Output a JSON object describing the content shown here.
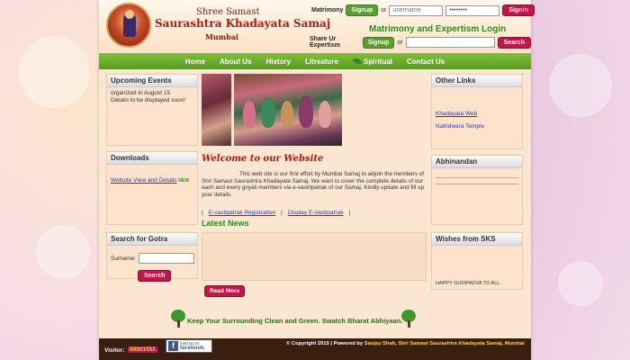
{
  "header": {
    "brand_small": "Shree Samast",
    "brand_big": "Saurashtra Khadayata Samaj",
    "brand_city": "Mumbai",
    "matrimony_label": "Matrimony",
    "signup_label": "Signup",
    "or_label": "or",
    "username_placeholder": "username",
    "password_value": "••••••••",
    "signin_label": "Signin",
    "login_title": "Matrimony and Expertism Login",
    "share_label": "Share Ur Expertism",
    "signup2_label": "Signup",
    "search_label": "Search"
  },
  "nav": {
    "items": [
      "Home",
      "About Us",
      "History",
      "Litreature",
      "Spiritual",
      "Contact Us"
    ]
  },
  "left": {
    "upcoming_title": "Upcoming Events",
    "upcoming_text_1": "organized in August 15",
    "upcoming_text_2": "Details to be displayed soon!",
    "downloads_title": "Downloads",
    "downloads_link_1": "Website View and Details",
    "new_badge": "NEW",
    "gotra_title": "Search for Gotra",
    "surname_label": "Surname:",
    "gotra_search_label": "Search"
  },
  "center": {
    "welcome_title": "Welcome to our Website",
    "welcome_text": "This web site is our first effort by Mumbai Samaj to adjoin the members of Shri Samast Saurashtra Khadayata Samaj. We want to cover the complete details of our each and every gnyati members via e-vastripatrak of our Samaj. Kindly update and fill up your details.",
    "link_1": "E-vastipatrak Registration",
    "link_2": "Display E-Vastipatrak",
    "news_title": "Latest News",
    "read_more_label": "Read More",
    "slogan": "Keep Your Surrounding Clean and Green. Swatch Bharat Abhiyaan."
  },
  "right": {
    "other_links_title": "Other Links",
    "link_1": "Khadayata Web",
    "link_2": "Nathdwara Temple",
    "abhinandan_title": "Abhinandan",
    "wishes_title": "Wishes from SKS",
    "wishes_text": "HAPPY GUDIPADVA TO ALL"
  },
  "footer": {
    "visitor_label": "Visitor:",
    "visitor_count": "00001551",
    "fb_line_1": "Find us on",
    "fb_line_2": "facebook.",
    "copyright_prefix": "© Copyright 2015 | Powered by ",
    "copyright_credit": "Sanjay Shah, Shri Samast Saurashtra Khadayata Samaj, Mumbai"
  }
}
